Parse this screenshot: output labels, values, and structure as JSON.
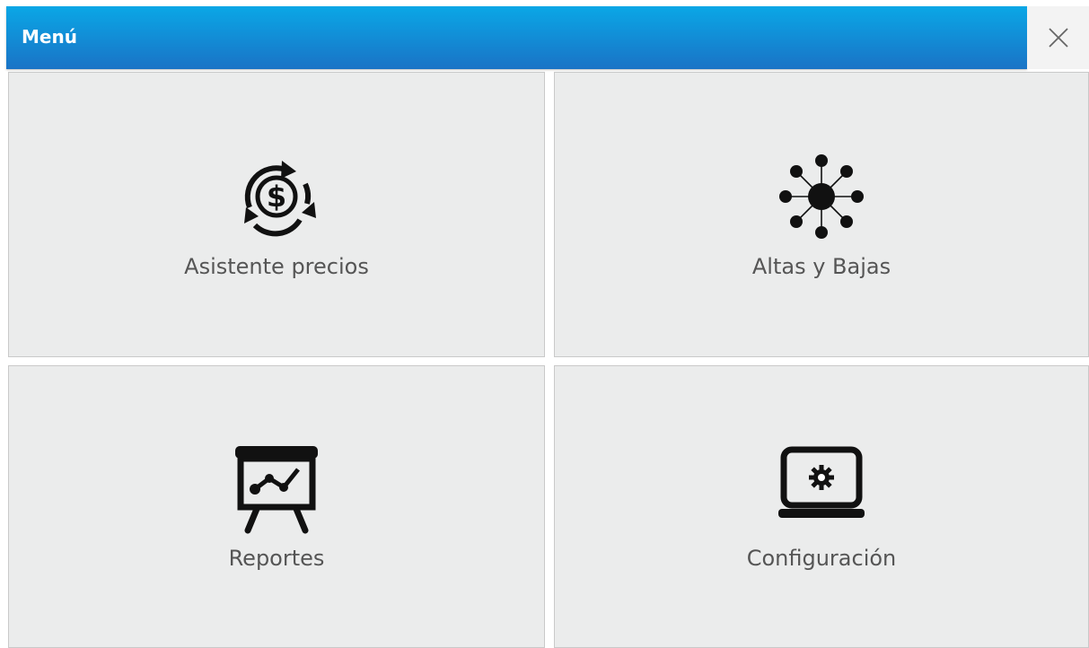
{
  "header": {
    "title": "Menú"
  },
  "tiles": [
    {
      "label": "Asistente precios",
      "icon": "price-assistant-icon"
    },
    {
      "label": "Altas y Bajas",
      "icon": "network-hub-icon"
    },
    {
      "label": "Reportes",
      "icon": "presentation-chart-icon"
    },
    {
      "label": "Configuración",
      "icon": "laptop-settings-icon"
    }
  ],
  "colors": {
    "header_top": "#0aa7e6",
    "header_bottom": "#1a73c6",
    "tile_bg": "#ebecec",
    "label_text": "#555555"
  }
}
